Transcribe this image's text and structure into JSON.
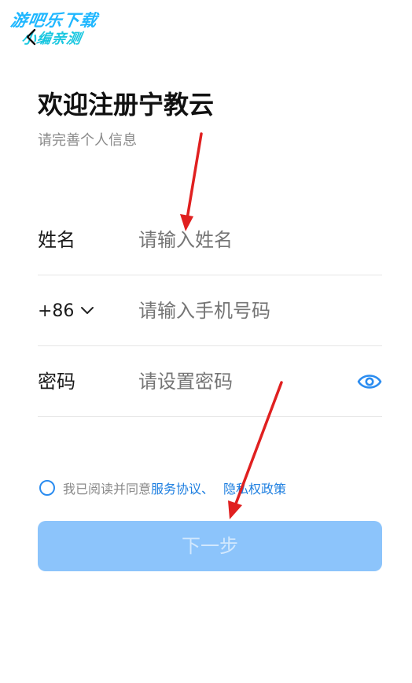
{
  "watermark": {
    "line1": "游吧乐下载",
    "line2": "小编亲测"
  },
  "header": {
    "back_icon": "chevron-left-icon"
  },
  "title": "欢迎注册宁教云",
  "subtitle": "请完善个人信息",
  "form": {
    "name": {
      "label": "姓名",
      "placeholder": "请输入姓名"
    },
    "phone": {
      "country_code": "+86",
      "placeholder": "请输入手机号码"
    },
    "password": {
      "label": "密码",
      "placeholder": "请设置密码",
      "icon": "eye-icon"
    }
  },
  "agreement": {
    "prefix": "我已阅读并同意",
    "service_link": "服务协议",
    "separator": "、",
    "privacy_link": "隐私权政策"
  },
  "next_button": "下一步",
  "colors": {
    "accent": "#2a8cf0",
    "button_bg": "#8cc4fb",
    "annotation_arrow": "#e02020"
  }
}
